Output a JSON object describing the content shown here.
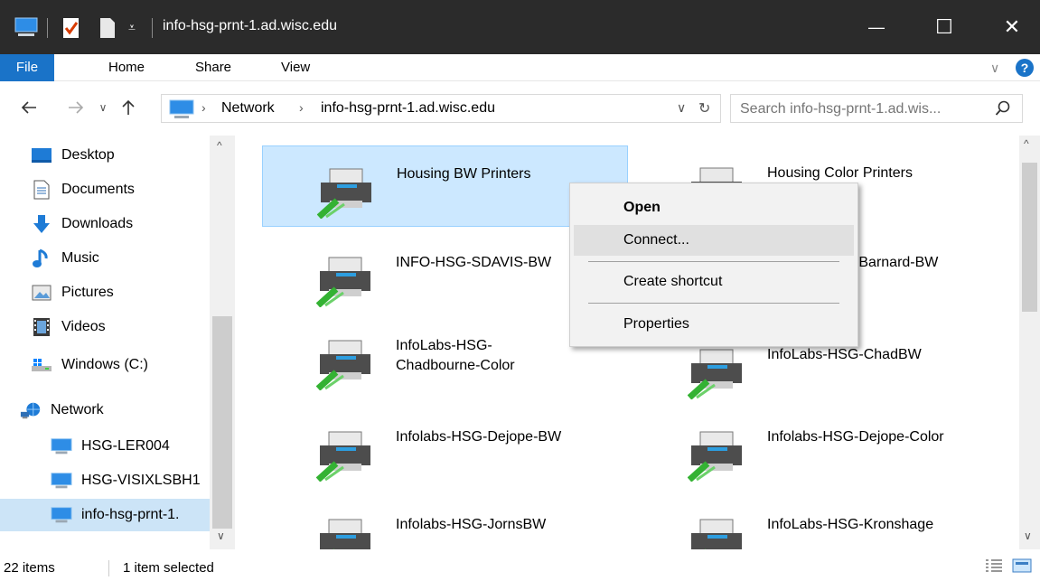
{
  "window": {
    "title": "info-hsg-prnt-1.ad.wisc.edu",
    "minimize": "—",
    "maximize": "☐",
    "close": "✕"
  },
  "ribbon": {
    "tabs": [
      "File",
      "Home",
      "Share",
      "View"
    ],
    "expand": "∨",
    "help": "?"
  },
  "address": {
    "crumbs": [
      "Network",
      "info-hsg-prnt-1.ad.wisc.edu"
    ],
    "separator": "›",
    "dropdown": "∨",
    "refresh": "↻"
  },
  "search": {
    "placeholder": "Search info-hsg-prnt-1.ad.wis..."
  },
  "nav": {
    "items": [
      {
        "label": "Desktop",
        "icon": "desktop-icon"
      },
      {
        "label": "Documents",
        "icon": "documents-icon"
      },
      {
        "label": "Downloads",
        "icon": "downloads-icon"
      },
      {
        "label": "Music",
        "icon": "music-icon"
      },
      {
        "label": "Pictures",
        "icon": "pictures-icon"
      },
      {
        "label": "Videos",
        "icon": "videos-icon"
      },
      {
        "label": "Windows (C:)",
        "icon": "drive-icon"
      },
      {
        "label": "Network",
        "icon": "network-icon"
      },
      {
        "label": "HSG-LER004",
        "icon": "computer-icon"
      },
      {
        "label": "HSG-VISIXLSBH1",
        "icon": "computer-icon"
      },
      {
        "label": "info-hsg-prnt-1.",
        "icon": "computer-icon"
      }
    ]
  },
  "printers": [
    {
      "label": "Housing BW Printers"
    },
    {
      "label": "Housing Color Printers"
    },
    {
      "label": "INFO-HSG-SDAVIS-BW"
    },
    {
      "label": "Infolabs-HSG-Barnard-BW"
    },
    {
      "label": "InfoLabs-HSG-Chadbourne-Color"
    },
    {
      "label": "InfoLabs-HSG-ChadBW"
    },
    {
      "label": "Infolabs-HSG-Dejope-BW"
    },
    {
      "label": "Infolabs-HSG-Dejope-Color"
    },
    {
      "label": "Infolabs-HSG-JornsBW"
    },
    {
      "label": "InfoLabs-HSG-Kronshage"
    }
  ],
  "context_menu": {
    "items": [
      "Open",
      "Connect...",
      "Create shortcut",
      "Properties"
    ]
  },
  "status": {
    "count": "22 items",
    "selection": "1 item selected"
  },
  "colors": {
    "accent": "#1a73c8",
    "selection": "#cce8ff",
    "titlebar": "#2b2b2b"
  }
}
